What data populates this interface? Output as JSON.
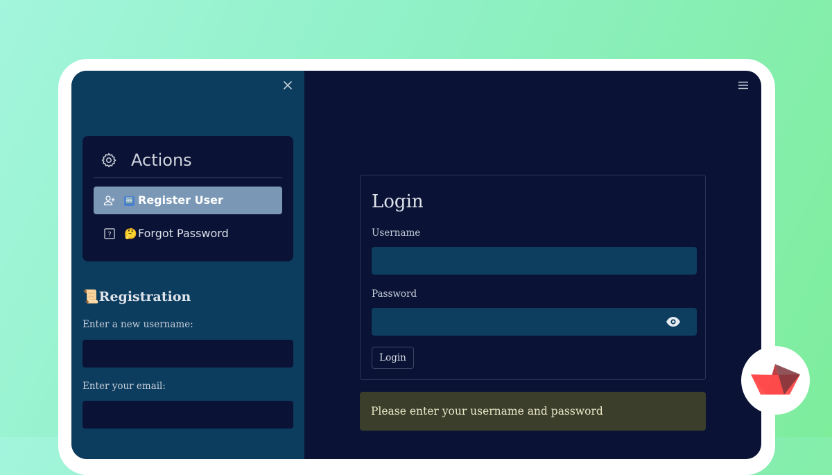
{
  "sidebar": {
    "actions": {
      "title": "Actions",
      "items": [
        {
          "emoji": "🆕",
          "label": "Register User",
          "active": true,
          "icon": "user-plus-icon"
        },
        {
          "emoji": "🤔",
          "label": "Forgot Password",
          "active": false,
          "icon": "question-square-icon"
        }
      ]
    },
    "registration": {
      "emoji": "📜",
      "title": "Registration",
      "username_label": "Enter a new username:",
      "email_label": "Enter your email:"
    }
  },
  "login": {
    "title": "Login",
    "username_label": "Username",
    "password_label": "Password",
    "button_label": "Login"
  },
  "alert": {
    "message": "Please enter your username and password"
  },
  "colors": {
    "sidebar_bg": "#0c3c5e",
    "main_bg": "#0a1236",
    "active_item": "#7a98b5",
    "alert_bg": "#3a3e2b",
    "brand_red": "#ff4b4b"
  }
}
